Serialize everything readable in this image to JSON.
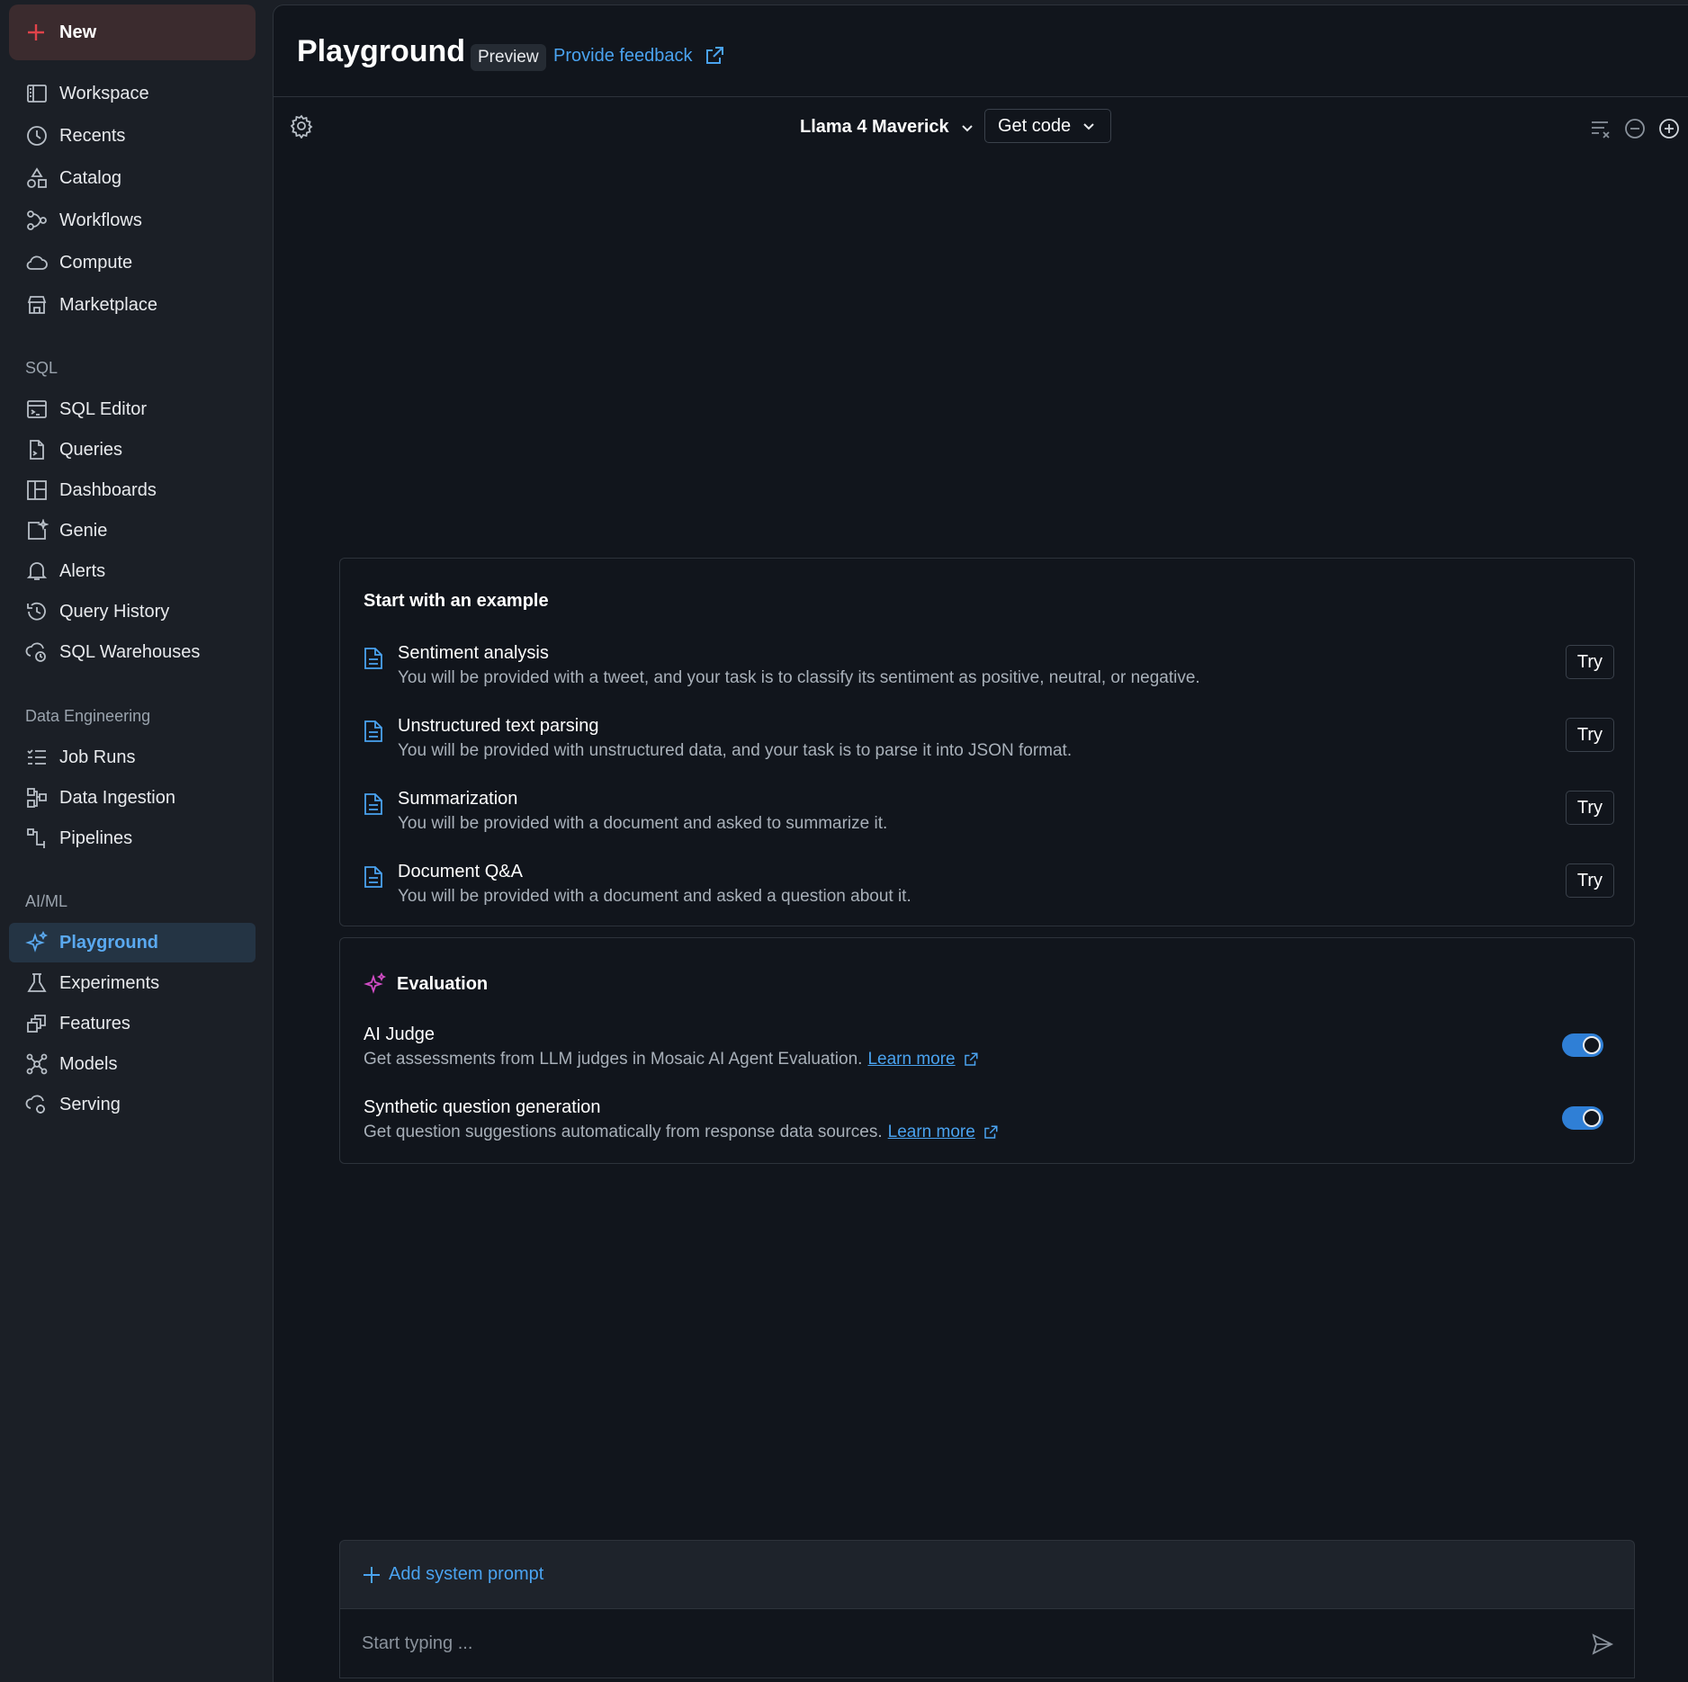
{
  "sidebar": {
    "new_label": "New",
    "top_items": [
      {
        "label": "Workspace",
        "icon": "workspace-icon"
      },
      {
        "label": "Recents",
        "icon": "clock-icon"
      },
      {
        "label": "Catalog",
        "icon": "catalog-icon"
      },
      {
        "label": "Workflows",
        "icon": "workflows-icon"
      },
      {
        "label": "Compute",
        "icon": "cloud-icon"
      },
      {
        "label": "Marketplace",
        "icon": "store-icon"
      }
    ],
    "sql_section": "SQL",
    "sql_items": [
      {
        "label": "SQL Editor",
        "icon": "terminal-icon"
      },
      {
        "label": "Queries",
        "icon": "query-file-icon"
      },
      {
        "label": "Dashboards",
        "icon": "dashboard-icon"
      },
      {
        "label": "Genie",
        "icon": "genie-icon"
      },
      {
        "label": "Alerts",
        "icon": "bell-icon"
      },
      {
        "label": "Query History",
        "icon": "history-icon"
      },
      {
        "label": "SQL Warehouses",
        "icon": "warehouse-icon"
      }
    ],
    "de_section": "Data Engineering",
    "de_items": [
      {
        "label": "Job Runs",
        "icon": "job-runs-icon"
      },
      {
        "label": "Data Ingestion",
        "icon": "data-ingestion-icon"
      },
      {
        "label": "Pipelines",
        "icon": "pipelines-icon"
      }
    ],
    "ml_section": "AI/ML",
    "ml_items": [
      {
        "label": "Playground",
        "icon": "sparkle-icon",
        "active": true
      },
      {
        "label": "Experiments",
        "icon": "flask-icon"
      },
      {
        "label": "Features",
        "icon": "features-icon"
      },
      {
        "label": "Models",
        "icon": "models-icon"
      },
      {
        "label": "Serving",
        "icon": "serving-icon"
      }
    ]
  },
  "header": {
    "title": "Playground",
    "badge": "Preview",
    "feedback_link": "Provide feedback"
  },
  "toolbar": {
    "model": "Llama 4 Maverick",
    "get_code": "Get code"
  },
  "examples": {
    "title": "Start with an example",
    "items": [
      {
        "title": "Sentiment analysis",
        "desc": "You will be provided with a tweet, and your task is to classify its sentiment as positive, neutral, or negative.",
        "action": "Try"
      },
      {
        "title": "Unstructured text parsing",
        "desc": "You will be provided with unstructured data, and your task is to parse it into JSON format.",
        "action": "Try"
      },
      {
        "title": "Summarization",
        "desc": "You will be provided with a document and asked to summarize it.",
        "action": "Try"
      },
      {
        "title": "Document Q&A",
        "desc": "You will be provided with a document and asked a question about it.",
        "action": "Try"
      }
    ]
  },
  "evaluation": {
    "title": "Evaluation",
    "items": [
      {
        "title": "AI Judge",
        "desc": "Get assessments from LLM judges in Mosaic AI Agent Evaluation.",
        "link": "Learn more",
        "enabled": true
      },
      {
        "title": "Synthetic question generation",
        "desc": "Get question suggestions automatically from response data sources.",
        "link": "Learn more",
        "enabled": true
      }
    ]
  },
  "prompt": {
    "add_system_prompt": "Add system prompt",
    "placeholder": "Start typing ..."
  },
  "colors": {
    "accent": "#4aa3f0",
    "new_button_bg": "#3b2b2e",
    "active_item_bg": "#243444",
    "toggle_on": "#2f7fd6",
    "sparkle": "#d04cc4"
  }
}
